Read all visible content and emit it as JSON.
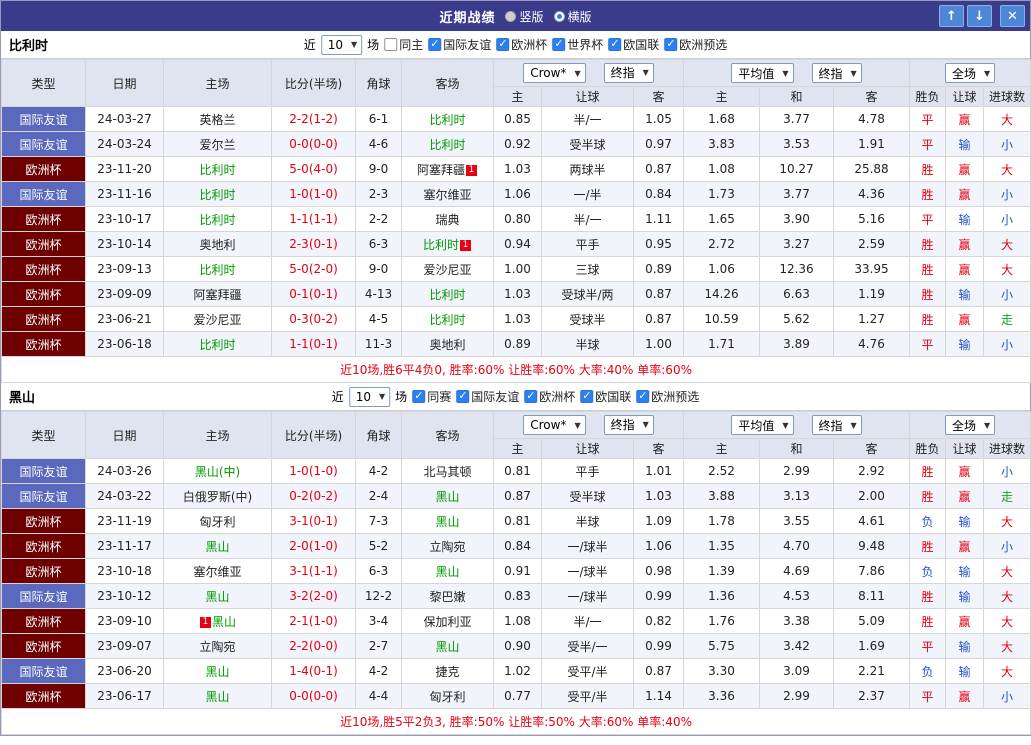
{
  "titlebar": {
    "title": "近期战绩",
    "radios": [
      {
        "label": "竖版",
        "selected": false
      },
      {
        "label": "横版",
        "selected": true
      }
    ],
    "buttons": {
      "up": "↑",
      "down": "↓",
      "close": "✕"
    }
  },
  "type_styles": {
    "国际友谊": "#5a68bd",
    "欧洲杯": "#6e0000"
  },
  "value_colors": {
    "胜": "#e60012",
    "平": "#e60012",
    "负": "#2653c5",
    "赢": "#e60012",
    "输": "#2653c5",
    "走": "#1e9e30",
    "大": "#e60012",
    "小": "#2653c5"
  },
  "table_header": {
    "type": "类型",
    "date": "日期",
    "home": "主场",
    "score": "比分(半场)",
    "corner": "角球",
    "away": "客场",
    "odds_provider": "Crow*",
    "odds_stage": "终指",
    "avg_provider": "平均值",
    "avg_stage": "终指",
    "scope": "全场",
    "odds_cols": [
      "主",
      "让球",
      "客"
    ],
    "avg_cols": [
      "主",
      "和",
      "客"
    ],
    "result_cols": [
      "胜负",
      "让球",
      "进球数"
    ]
  },
  "sections": [
    {
      "team": "比利时",
      "filter": {
        "prefix": "近",
        "count": "10",
        "suffix": "场",
        "checkboxes": [
          {
            "label": "同主",
            "checked": false
          },
          {
            "label": "国际友谊",
            "checked": true
          },
          {
            "label": "欧洲杯",
            "checked": true
          },
          {
            "label": "世界杯",
            "checked": true
          },
          {
            "label": "欧国联",
            "checked": true
          },
          {
            "label": "欧洲预选",
            "checked": true
          }
        ]
      },
      "rows": [
        {
          "type": "国际友谊",
          "date": "24-03-27",
          "home": "英格兰",
          "score": "2-2(1-2)",
          "corner": "6-1",
          "away": "比利时",
          "away_focus": true,
          "odds": [
            "0.85",
            "半/一",
            "1.05"
          ],
          "avg": [
            "1.68",
            "3.77",
            "4.78"
          ],
          "results": [
            "平",
            "赢",
            "大"
          ]
        },
        {
          "type": "国际友谊",
          "date": "24-03-24",
          "home": "爱尔兰",
          "score": "0-0(0-0)",
          "corner": "4-6",
          "away": "比利时",
          "away_focus": true,
          "odds": [
            "0.92",
            "受半球",
            "0.97"
          ],
          "avg": [
            "3.83",
            "3.53",
            "1.91"
          ],
          "results": [
            "平",
            "输",
            "小"
          ]
        },
        {
          "type": "欧洲杯",
          "date": "23-11-20",
          "home": "比利时",
          "home_focus": true,
          "score": "5-0(4-0)",
          "corner": "9-0",
          "away": "阿塞拜疆",
          "away_card": "1",
          "away_card_pos": "after",
          "odds": [
            "1.03",
            "两球半",
            "0.87"
          ],
          "avg": [
            "1.08",
            "10.27",
            "25.88"
          ],
          "results": [
            "胜",
            "赢",
            "大"
          ]
        },
        {
          "type": "国际友谊",
          "date": "23-11-16",
          "home": "比利时",
          "home_focus": true,
          "score": "1-0(1-0)",
          "corner": "2-3",
          "away": "塞尔维亚",
          "odds": [
            "1.06",
            "一/半",
            "0.84"
          ],
          "avg": [
            "1.73",
            "3.77",
            "4.36"
          ],
          "results": [
            "胜",
            "赢",
            "小"
          ]
        },
        {
          "type": "欧洲杯",
          "date": "23-10-17",
          "home": "比利时",
          "home_focus": true,
          "score": "1-1(1-1)",
          "corner": "2-2",
          "away": "瑞典",
          "odds": [
            "0.80",
            "半/一",
            "1.11"
          ],
          "avg": [
            "1.65",
            "3.90",
            "5.16"
          ],
          "results": [
            "平",
            "输",
            "小"
          ]
        },
        {
          "type": "欧洲杯",
          "date": "23-10-14",
          "home": "奥地利",
          "score": "2-3(0-1)",
          "corner": "6-3",
          "away": "比利时",
          "away_focus": true,
          "away_card": "1",
          "away_card_pos": "after",
          "odds": [
            "0.94",
            "平手",
            "0.95"
          ],
          "avg": [
            "2.72",
            "3.27",
            "2.59"
          ],
          "results": [
            "胜",
            "赢",
            "大"
          ]
        },
        {
          "type": "欧洲杯",
          "date": "23-09-13",
          "home": "比利时",
          "home_focus": true,
          "score": "5-0(2-0)",
          "corner": "9-0",
          "away": "爱沙尼亚",
          "odds": [
            "1.00",
            "三球",
            "0.89"
          ],
          "avg": [
            "1.06",
            "12.36",
            "33.95"
          ],
          "results": [
            "胜",
            "赢",
            "大"
          ]
        },
        {
          "type": "欧洲杯",
          "date": "23-09-09",
          "home": "阿塞拜疆",
          "score": "0-1(0-1)",
          "corner": "4-13",
          "away": "比利时",
          "away_focus": true,
          "odds": [
            "1.03",
            "受球半/两",
            "0.87"
          ],
          "avg": [
            "14.26",
            "6.63",
            "1.19"
          ],
          "results": [
            "胜",
            "输",
            "小"
          ]
        },
        {
          "type": "欧洲杯",
          "date": "23-06-21",
          "home": "爱沙尼亚",
          "score": "0-3(0-2)",
          "corner": "4-5",
          "away": "比利时",
          "away_focus": true,
          "odds": [
            "1.03",
            "受球半",
            "0.87"
          ],
          "avg": [
            "10.59",
            "5.62",
            "1.27"
          ],
          "results": [
            "胜",
            "赢",
            "走"
          ]
        },
        {
          "type": "欧洲杯",
          "date": "23-06-18",
          "home": "比利时",
          "home_focus": true,
          "score": "1-1(0-1)",
          "corner": "11-3",
          "away": "奥地利",
          "odds": [
            "0.89",
            "半球",
            "1.00"
          ],
          "avg": [
            "1.71",
            "3.89",
            "4.76"
          ],
          "results": [
            "平",
            "输",
            "小"
          ]
        }
      ],
      "summary": "近10场,胜6平4负0, 胜率:60% 让胜率:60% 大率:40% 单率:60%"
    },
    {
      "team": "黑山",
      "filter": {
        "prefix": "近",
        "count": "10",
        "suffix": "场",
        "checkboxes": [
          {
            "label": "同赛",
            "checked": true
          },
          {
            "label": "国际友谊",
            "checked": true
          },
          {
            "label": "欧洲杯",
            "checked": true
          },
          {
            "label": "欧国联",
            "checked": true
          },
          {
            "label": "欧洲预选",
            "checked": true
          }
        ]
      },
      "rows": [
        {
          "type": "国际友谊",
          "date": "24-03-26",
          "home": "黑山(中)",
          "home_focus": true,
          "score": "1-0(1-0)",
          "corner": "4-2",
          "away": "北马其顿",
          "odds": [
            "0.81",
            "平手",
            "1.01"
          ],
          "avg": [
            "2.52",
            "2.99",
            "2.92"
          ],
          "results": [
            "胜",
            "赢",
            "小"
          ]
        },
        {
          "type": "国际友谊",
          "date": "24-03-22",
          "home": "白俄罗斯(中)",
          "score": "0-2(0-2)",
          "corner": "2-4",
          "away": "黑山",
          "away_focus": true,
          "odds": [
            "0.87",
            "受半球",
            "1.03"
          ],
          "avg": [
            "3.88",
            "3.13",
            "2.00"
          ],
          "results": [
            "胜",
            "赢",
            "走"
          ]
        },
        {
          "type": "欧洲杯",
          "date": "23-11-19",
          "home": "匈牙利",
          "score": "3-1(0-1)",
          "corner": "7-3",
          "away": "黑山",
          "away_focus": true,
          "odds": [
            "0.81",
            "半球",
            "1.09"
          ],
          "avg": [
            "1.78",
            "3.55",
            "4.61"
          ],
          "results": [
            "负",
            "输",
            "大"
          ]
        },
        {
          "type": "欧洲杯",
          "date": "23-11-17",
          "home": "黑山",
          "home_focus": true,
          "score": "2-0(1-0)",
          "corner": "5-2",
          "away": "立陶宛",
          "odds": [
            "0.84",
            "一/球半",
            "1.06"
          ],
          "avg": [
            "1.35",
            "4.70",
            "9.48"
          ],
          "results": [
            "胜",
            "赢",
            "小"
          ]
        },
        {
          "type": "欧洲杯",
          "date": "23-10-18",
          "home": "塞尔维亚",
          "score": "3-1(1-1)",
          "corner": "6-3",
          "away": "黑山",
          "away_focus": true,
          "odds": [
            "0.91",
            "一/球半",
            "0.98"
          ],
          "avg": [
            "1.39",
            "4.69",
            "7.86"
          ],
          "results": [
            "负",
            "输",
            "大"
          ]
        },
        {
          "type": "国际友谊",
          "date": "23-10-12",
          "home": "黑山",
          "home_focus": true,
          "score": "3-2(2-0)",
          "corner": "12-2",
          "away": "黎巴嫩",
          "odds": [
            "0.83",
            "一/球半",
            "0.99"
          ],
          "avg": [
            "1.36",
            "4.53",
            "8.11"
          ],
          "results": [
            "胜",
            "输",
            "大"
          ]
        },
        {
          "type": "欧洲杯",
          "date": "23-09-10",
          "home": "黑山",
          "home_focus": true,
          "home_card": "1",
          "home_card_pos": "before",
          "score": "2-1(1-0)",
          "corner": "3-4",
          "away": "保加利亚",
          "odds": [
            "1.08",
            "半/一",
            "0.82"
          ],
          "avg": [
            "1.76",
            "3.38",
            "5.09"
          ],
          "results": [
            "胜",
            "赢",
            "大"
          ]
        },
        {
          "type": "欧洲杯",
          "date": "23-09-07",
          "home": "立陶宛",
          "score": "2-2(0-0)",
          "corner": "2-7",
          "away": "黑山",
          "away_focus": true,
          "odds": [
            "0.90",
            "受半/一",
            "0.99"
          ],
          "avg": [
            "5.75",
            "3.42",
            "1.69"
          ],
          "results": [
            "平",
            "输",
            "大"
          ]
        },
        {
          "type": "国际友谊",
          "date": "23-06-20",
          "home": "黑山",
          "home_focus": true,
          "score": "1-4(0-1)",
          "corner": "4-2",
          "away": "捷克",
          "odds": [
            "1.02",
            "受平/半",
            "0.87"
          ],
          "avg": [
            "3.30",
            "3.09",
            "2.21"
          ],
          "results": [
            "负",
            "输",
            "大"
          ]
        },
        {
          "type": "欧洲杯",
          "date": "23-06-17",
          "home": "黑山",
          "home_focus": true,
          "score": "0-0(0-0)",
          "corner": "4-4",
          "away": "匈牙利",
          "odds": [
            "0.77",
            "受平/半",
            "1.14"
          ],
          "avg": [
            "3.36",
            "2.99",
            "2.37"
          ],
          "results": [
            "平",
            "赢",
            "小"
          ]
        }
      ],
      "summary": "近10场,胜5平2负3, 胜率:50% 让胜率:50% 大率:60% 单率:40%"
    }
  ]
}
